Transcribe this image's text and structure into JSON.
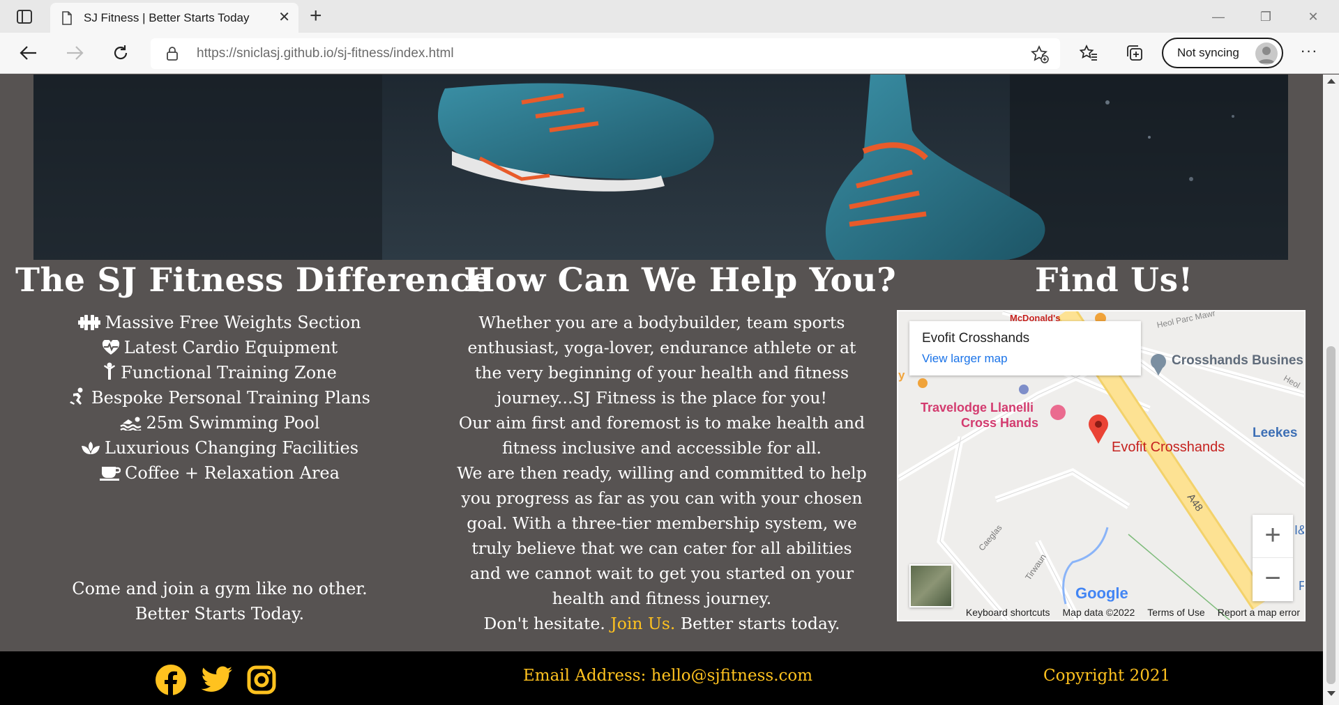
{
  "browser": {
    "tab_title": "SJ Fitness | Better Starts Today",
    "url_host": "https://sniclasj.github.io",
    "url_path": "/sj-fitness/index.html",
    "sync_label": "Not syncing",
    "icons": [
      "tab-actions-icon",
      "page-icon",
      "close-icon",
      "new-tab-icon",
      "back-icon",
      "forward-icon",
      "refresh-icon",
      "lock-icon",
      "add-favorite-icon",
      "favorites-icon",
      "collections-icon",
      "more-icon"
    ]
  },
  "difference": {
    "title": "The SJ Fitness Difference",
    "features": [
      {
        "icon": "dumbbell-icon",
        "label": "Massive Free Weights Section"
      },
      {
        "icon": "heartbeat-icon",
        "label": "Latest Cardio Equipment"
      },
      {
        "icon": "fitness-figure-icon",
        "label": "Functional Training Zone"
      },
      {
        "icon": "skating-figure-icon",
        "label": "Bespoke Personal Training Plans"
      },
      {
        "icon": "swimmer-icon",
        "label": "25m Swimming Pool"
      },
      {
        "icon": "spa-icon",
        "label": "Luxurious Changing Facilities"
      },
      {
        "icon": "coffee-icon",
        "label": "Coffee + Relaxation Area"
      }
    ],
    "tagline_1": "Come and join a gym like no other.",
    "tagline_2": "Better Starts Today."
  },
  "help": {
    "title": "How Can We Help You?",
    "paragraph_1": "Whether you are a bodybuilder, team sports enthusiast, yoga-lover, endurance athlete or at the very beginning of your health and fitness journey...SJ Fitness is the place for you!",
    "paragraph_2": "Our aim first and foremost is to make health and fitness inclusive and accessible for all.",
    "paragraph_3": "We are then ready, willing and committed to help you progress as far as you can with your chosen goal. With a three-tier membership system, we truly believe that we can cater for all abilities and we cannot wait to get you started on your health and fitness journey.",
    "closing_before": "Don't hesitate.",
    "join_link": "Join Us.",
    "closing_after": "Better starts today."
  },
  "find_us": {
    "title": "Find Us!",
    "map": {
      "place_name": "Evofit Crosshands",
      "view_larger": "View larger map",
      "labels": {
        "mcdonalds": "McDonald's",
        "heol_parc_mawr": "Heol Parc Mawr",
        "crosshands_business": "Crosshands Busines",
        "heol": "Heol",
        "travelodge_1": "Travelodge Llanelli",
        "travelodge_2": "Cross Hands",
        "pin_label": "Evofit Crosshands",
        "leekes": "Leekes",
        "a48": "A48",
        "caeglas": "Caeglas",
        "tirwaun": "Tirwaun",
        "edge_y": "y",
        "edge_ib": "I&",
        "edge_f": "F"
      },
      "zoom_in": "+",
      "zoom_out": "−",
      "google": "Google",
      "attribution": [
        "Keyboard shortcuts",
        "Map data ©2022",
        "Terms of Use",
        "Report a map error"
      ],
      "colors": {
        "road_major": "#fde293",
        "pin": "#ea4335",
        "water": "#8ab4f8",
        "park": "#c6e8c1"
      }
    }
  },
  "footer": {
    "email": "Email Address: hello@sjfitness.com",
    "copyright": "Copyright 2021",
    "social": [
      "facebook-icon",
      "twitter-icon",
      "instagram-icon"
    ],
    "accent": "#ffc21f"
  }
}
